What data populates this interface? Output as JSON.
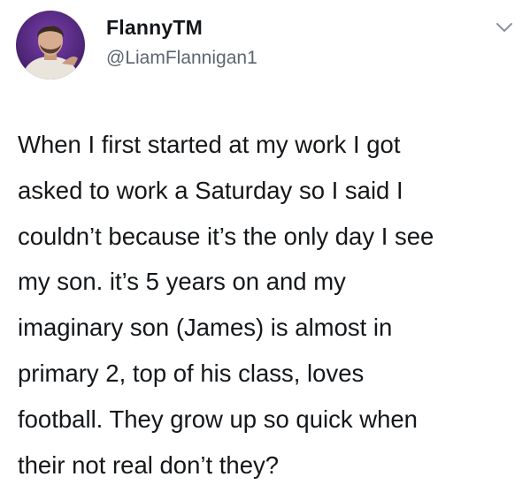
{
  "author": {
    "display_name": "FlannyTM",
    "handle": "@LiamFlannigan1",
    "avatar_icon": "profile-photo-avatar",
    "menu_icon": "chevron-down-icon"
  },
  "tweet": {
    "lines": [
      "When I first started at my work I got",
      "asked to work a Saturday so I said I",
      "couldn’t because it’s the only day I see",
      "my son. it’s 5 years on and my",
      "imaginary son (James) is almost in",
      "primary 2, top of his class, loves",
      "football. They grow up so quick when",
      "their not real don’t they?"
    ]
  },
  "colors": {
    "text": "#14171a",
    "secondary_text": "#5b6570",
    "background": "#ffffff",
    "avatar_bg": "#5a2a8a"
  }
}
